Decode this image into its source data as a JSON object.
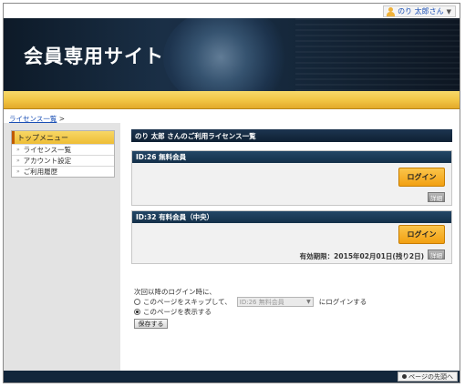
{
  "user_menu": {
    "name": "のり 太郎さん",
    "caret": "▼"
  },
  "site": {
    "title": "会員専用サイト"
  },
  "breadcrumb": {
    "link": "ライセンス一覧",
    "separator": ">"
  },
  "sidebar": {
    "header": "トップメニュー",
    "items": [
      {
        "label": "ライセンス一覧"
      },
      {
        "label": "アカウント設定"
      },
      {
        "label": "ご利用履歴"
      }
    ]
  },
  "main": {
    "heading": "のり 太郎 さんのご利用ライセンス一覧",
    "licenses": [
      {
        "title": "ID:26 無料会員",
        "login_label": "ログイン",
        "detail_label": "詳細",
        "expiry": ""
      },
      {
        "title": "ID:32 有料会員（中央）",
        "login_label": "ログイン",
        "detail_label": "詳細",
        "expiry": "有効期限：2015年02月01日(残り2日)"
      }
    ]
  },
  "preferences": {
    "intro": "次回以降のログイン時に、",
    "option_skip_prefix": "このページをスキップして、",
    "option_skip_select": "ID:26 無料会員",
    "option_skip_suffix": "にログインする",
    "option_show": "このページを表示する",
    "save_label": "保存する"
  },
  "footer": {
    "to_top": "ページの先頭へ"
  }
}
